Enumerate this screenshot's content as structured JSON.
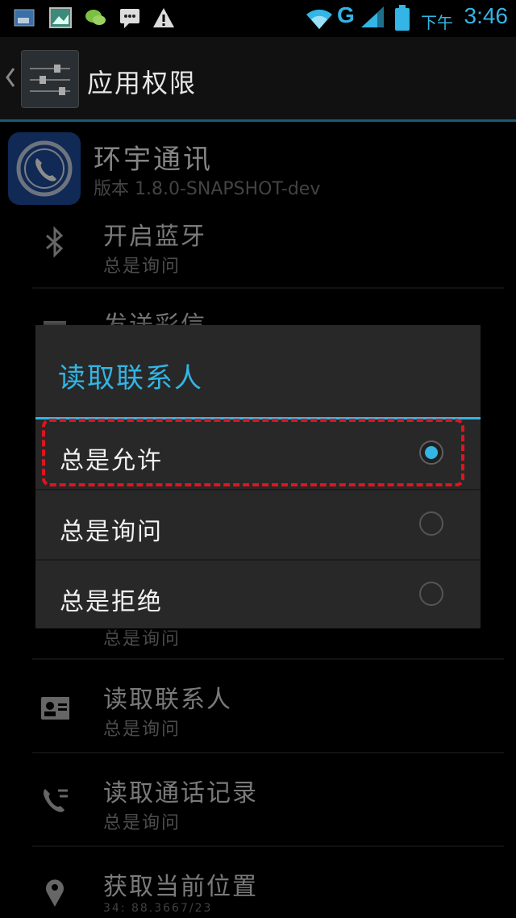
{
  "status_bar": {
    "network_type": "G",
    "time_prefix": "下午",
    "time": "3:46",
    "icons": [
      "image-notification-icon",
      "photo-notification-icon",
      "wechat-notification-icon",
      "message-notification-icon",
      "warning-icon",
      "wifi-icon",
      "signal-icon",
      "battery-icon"
    ],
    "accent": "#33b5e5"
  },
  "action_bar": {
    "title": "应用权限",
    "icons": [
      "back-chevron-icon",
      "settings-app-icon"
    ]
  },
  "app": {
    "name": "环宇通讯",
    "version": "版本 1.8.0-SNAPSHOT-dev",
    "icon": "phone-app-icon",
    "brand_color": "#1e4d9c"
  },
  "permissions": [
    {
      "title": "开启蓝牙",
      "status": "总是询问",
      "icon": "bluetooth-icon"
    },
    {
      "title": "发送彩信",
      "status": "",
      "icon": "mms-icon"
    },
    {
      "title": "",
      "status": "总是询问",
      "icon": ""
    },
    {
      "title": "读取联系人",
      "status": "总是询问",
      "icon": "contact-card-icon"
    },
    {
      "title": "读取通话记录",
      "status": "总是询问",
      "icon": "call-log-icon"
    },
    {
      "title": "获取当前位置",
      "status": "34: 88.3667/23",
      "icon": "location-pin-icon"
    }
  ],
  "dialog": {
    "title": "读取联系人",
    "options": [
      {
        "label": "总是允许",
        "selected": true
      },
      {
        "label": "总是询问",
        "selected": false
      },
      {
        "label": "总是拒绝",
        "selected": false
      }
    ],
    "highlight_color": "#e0141e",
    "accent": "#33b5e5"
  }
}
